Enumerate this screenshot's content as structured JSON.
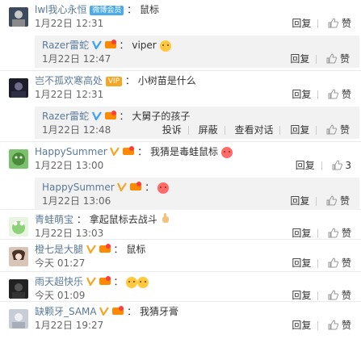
{
  "comments": [
    {
      "user": "lwl我心永恒",
      "badge": "微博会员",
      "sep": "：",
      "text": "鼠标",
      "time": "1月22日 12:31",
      "reply_label": "回复",
      "like_label": "赞",
      "replies": [
        {
          "user": "Razer雷蛇",
          "sep": "：",
          "text": "viper",
          "time": "1月22日 12:47",
          "reply_label": "回复",
          "like_label": "赞"
        }
      ]
    },
    {
      "user": "岂不孤欢寒高处",
      "badge": "VIP",
      "sep": "：",
      "text": "小树苗是什么",
      "time": "1月22日 12:31",
      "reply_label": "回复",
      "like_label": "赞",
      "replies": [
        {
          "user": "Razer雷蛇",
          "sep": "：",
          "text": "大舅子的孩子",
          "time": "1月22日 12:48",
          "report_label": "投诉",
          "block_label": "屏蔽",
          "view_label": "查看对话",
          "reply_label": "回复",
          "like_label": "赞"
        }
      ]
    },
    {
      "user": "HappySummer",
      "sep": "：",
      "text": "我猜是毒蛙鼠标",
      "time": "1月22日 13:00",
      "reply_label": "回复",
      "like_count": "3",
      "replies": [
        {
          "user": "HappySummer",
          "sep": "：",
          "text": "",
          "time": "1月22日 13:06",
          "reply_label": "回复",
          "like_label": "赞"
        }
      ]
    },
    {
      "user": "青蛙萌宝",
      "sep": "：",
      "text": "拿起鼠标去战斗",
      "time": "1月22日 13:03",
      "reply_label": "回复",
      "like_label": "赞"
    },
    {
      "user": "橙七是大腿",
      "sep": "：",
      "text": "鼠标",
      "time": "今天 01:27",
      "reply_label": "回复",
      "like_label": "赞"
    },
    {
      "user": "雨天超快乐",
      "sep": "：",
      "text": "",
      "time": "今天 01:09",
      "reply_label": "回复",
      "like_label": "赞"
    },
    {
      "user": "缺颗牙_SAMA",
      "sep": "：",
      "text": "我猜牙膏",
      "time": "1月22日 19:27",
      "reply_label": "回复",
      "like_label": "赞"
    }
  ],
  "colors": {
    "username": "#5a7a9a",
    "reply_bg": "#f2f2f2",
    "vip_blue": "#3aa0ff"
  }
}
